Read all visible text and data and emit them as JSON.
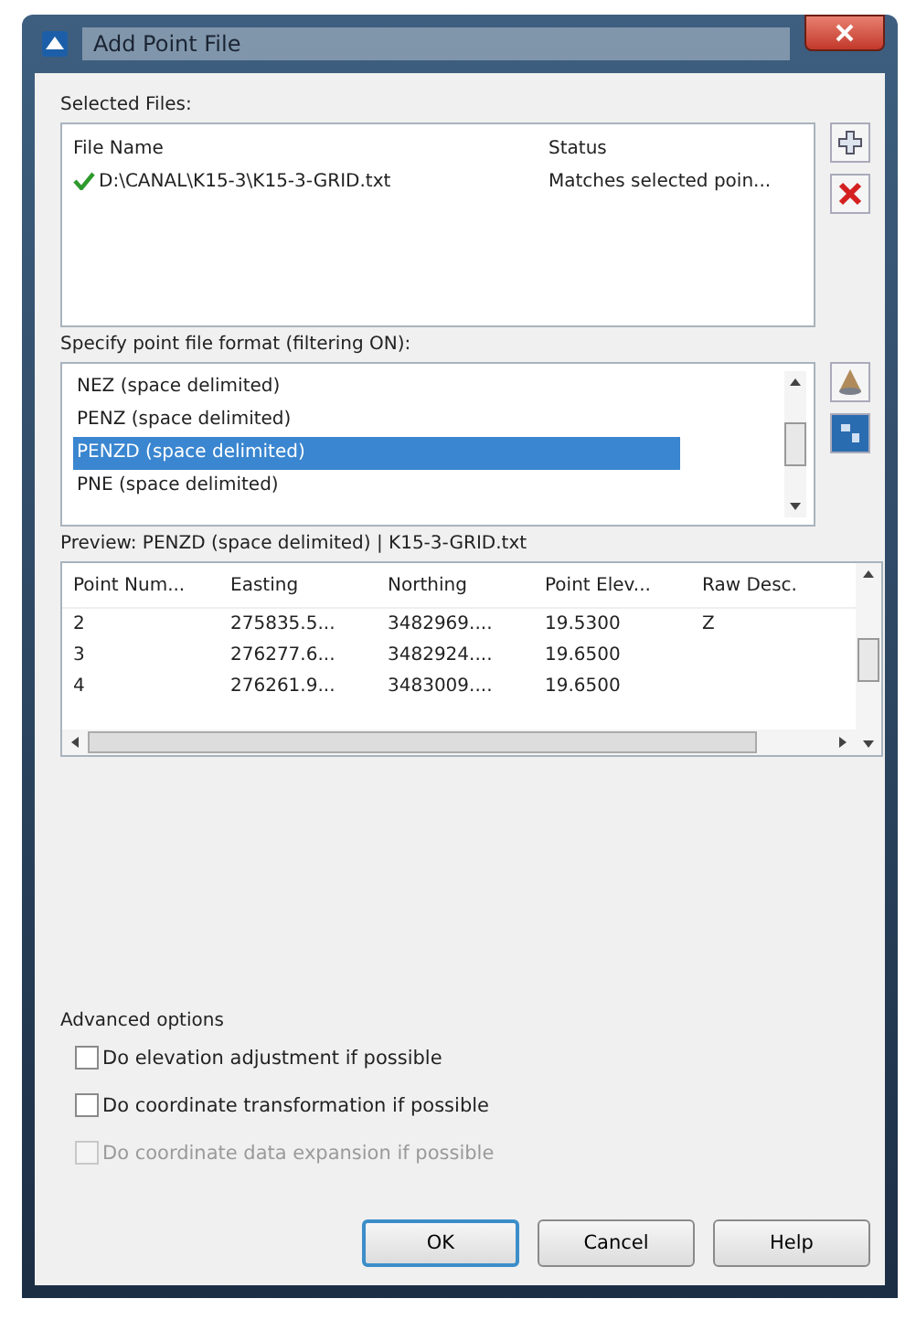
{
  "window": {
    "title": "Add Point File"
  },
  "selected_files": {
    "label": "Selected Files:",
    "columns": [
      "File Name",
      "Status"
    ],
    "rows": [
      {
        "file_name": "D:\\CANAL\\K15-3\\K15-3-GRID.txt",
        "status": "Matches selected poin...",
        "valid": true
      }
    ]
  },
  "format": {
    "label": "Specify point file format (filtering ON):",
    "items": [
      {
        "label": "NEZ (space delimited)",
        "selected": false
      },
      {
        "label": "PENZ (space delimited)",
        "selected": false
      },
      {
        "label": "PENZD (space delimited)",
        "selected": true
      },
      {
        "label": "PNE (space delimited)",
        "selected": false
      }
    ]
  },
  "preview": {
    "label": "Preview: PENZD (space delimited) | K15-3-GRID.txt",
    "columns": [
      "Point Num...",
      "Easting",
      "Northing",
      "Point Elev...",
      "Raw Desc."
    ],
    "rows": [
      [
        "2",
        "275835.5...",
        "3482969....",
        "19.5300",
        "Z"
      ],
      [
        "3",
        "276277.6...",
        "3482924....",
        "19.6500",
        ""
      ],
      [
        "4",
        "276261.9...",
        "3483009....",
        "19.6500",
        ""
      ]
    ]
  },
  "advanced": {
    "label": "Advanced options",
    "options": [
      {
        "label": "Do elevation adjustment if possible",
        "checked": false,
        "disabled": false
      },
      {
        "label": "Do coordinate transformation if possible",
        "checked": false,
        "disabled": false
      },
      {
        "label": "Do coordinate data expansion if possible",
        "checked": false,
        "disabled": true
      }
    ]
  },
  "buttons": [
    {
      "label": "OK",
      "default": true
    },
    {
      "label": "Cancel",
      "default": false
    },
    {
      "label": "Help",
      "default": false
    }
  ]
}
